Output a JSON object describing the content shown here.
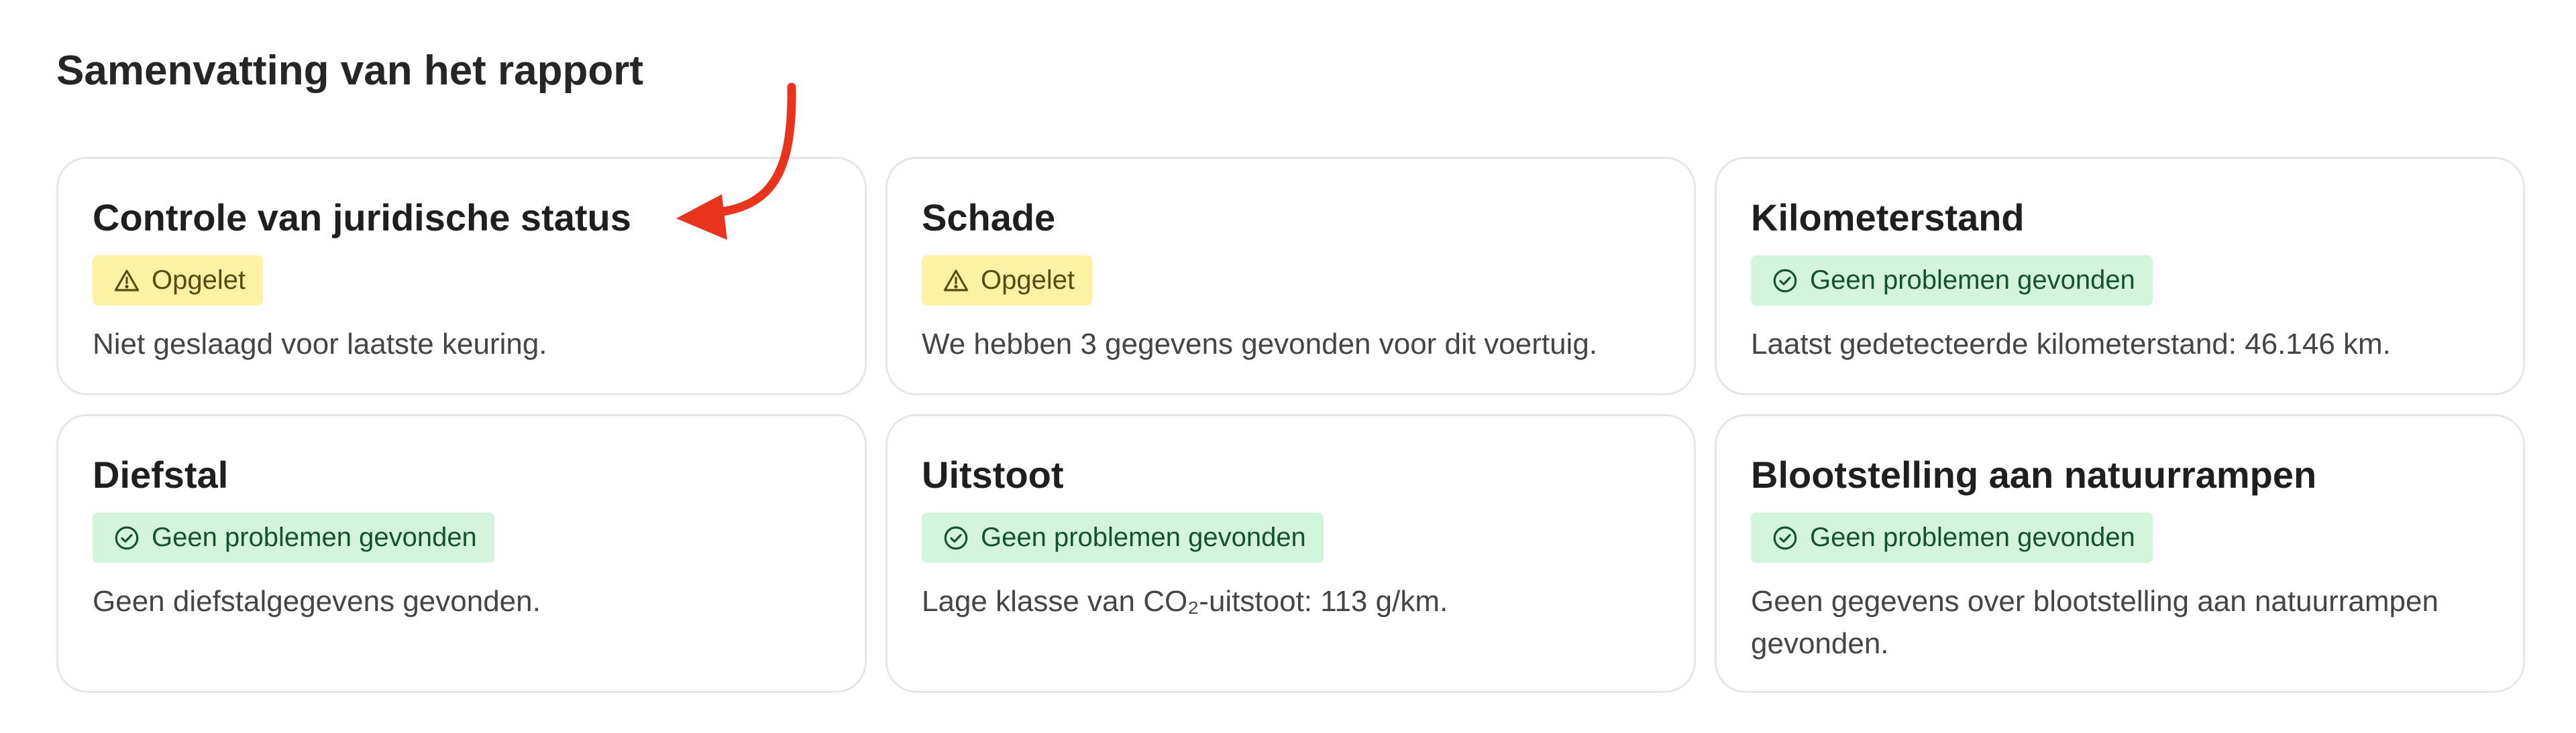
{
  "page": {
    "title": "Samenvatting van het rapport"
  },
  "cards": [
    {
      "title": "Controle van juridische status",
      "status": "warning",
      "badge": "Opgelet",
      "description": "Niet geslaagd voor laatste keuring."
    },
    {
      "title": "Schade",
      "status": "warning",
      "badge": "Opgelet",
      "description": "We hebben 3 gegevens gevonden voor dit voertuig."
    },
    {
      "title": "Kilometerstand",
      "status": "ok",
      "badge": "Geen problemen gevonden",
      "description": "Laatst gedetecteerde kilometerstand: 46.146 km."
    },
    {
      "title": "Diefstal",
      "status": "ok",
      "badge": "Geen problemen gevonden",
      "description": "Geen diefstalgegevens gevonden."
    },
    {
      "title": "Uitstoot",
      "status": "ok",
      "badge": "Geen problemen gevonden",
      "description": "Lage klasse van CO₂-uitstoot: 113 g/km."
    },
    {
      "title": "Blootstelling aan natuurrampen",
      "status": "ok",
      "badge": "Geen problemen gevonden",
      "description": "Geen gegevens over blootstelling aan natuurrampen gevonden."
    }
  ],
  "icons": {
    "warning": "warning-triangle-icon",
    "ok": "check-circle-icon",
    "annotation": "red-arrow-icon"
  },
  "colors": {
    "warning_bg": "#fdf2a3",
    "ok_bg": "#d3f5dc",
    "arrow": "#e8341c"
  }
}
